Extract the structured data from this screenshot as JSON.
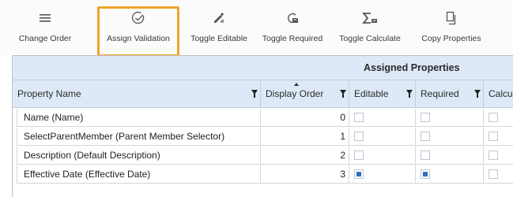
{
  "toolbar": {
    "items": [
      {
        "label": "Change Order",
        "icon": "hamburger-icon"
      },
      {
        "label": "Assign Validation",
        "icon": "check-circle-icon"
      },
      {
        "label": "Toggle Editable",
        "icon": "edit-icon"
      },
      {
        "label": "Toggle Required",
        "icon": "required-icon"
      },
      {
        "label": "Toggle Calculate",
        "icon": "sigma-icon"
      },
      {
        "label": "Copy Properties",
        "icon": "copy-icon"
      }
    ],
    "highlighted": "Assign Validation",
    "highlight_color": "#f0a428"
  },
  "grid": {
    "group_title": "Assigned Properties",
    "columns": [
      "Property Name",
      "Display Order",
      "Editable",
      "Required",
      "Calcu"
    ],
    "rows": [
      {
        "name": "Name (Name)",
        "order": "0",
        "editable": false,
        "required": false,
        "calc": false
      },
      {
        "name": "SelectParentMember (Parent Member Selector)",
        "order": "1",
        "editable": false,
        "required": false,
        "calc": false
      },
      {
        "name": "Description (Default Description)",
        "order": "2",
        "editable": false,
        "required": false,
        "calc": false
      },
      {
        "name": "Effective Date (Effective Date)",
        "order": "3",
        "editable": true,
        "required": true,
        "calc": false
      }
    ]
  },
  "colors": {
    "header_bg": "#dde9f7",
    "checkbox_on": "#2f6fbf"
  }
}
